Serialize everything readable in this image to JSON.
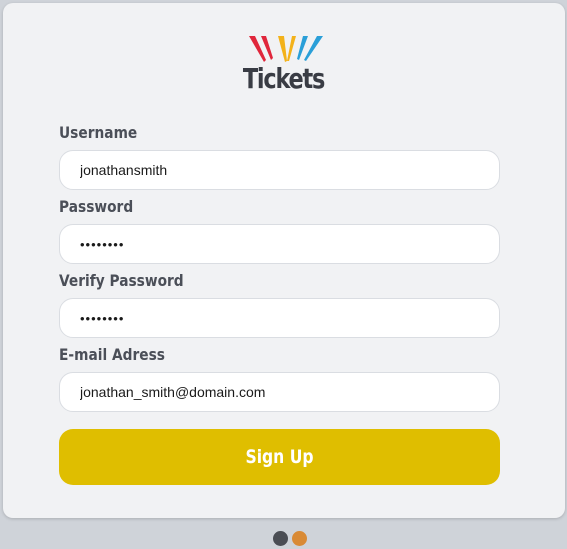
{
  "brand": {
    "name": "Tickets",
    "logo_icon": "ticket-rays-logo",
    "logo_colors": [
      "#e0263b",
      "#f3b21a",
      "#2a9fd8"
    ]
  },
  "form": {
    "fields": [
      {
        "label": "Username",
        "type": "text",
        "value": "jonathansmith"
      },
      {
        "label": "Password",
        "type": "password",
        "value": "••••••••"
      },
      {
        "label": "Verify Password",
        "type": "password",
        "value": "••••••••"
      },
      {
        "label": "E-mail Adress",
        "type": "email",
        "value": "jonathan_smith@domain.com"
      }
    ],
    "submit_label": "Sign Up"
  },
  "pager": {
    "dots": [
      {
        "state": "active",
        "color": "#4a4d54"
      },
      {
        "state": "inactive",
        "color": "#d98a35"
      }
    ]
  },
  "colors": {
    "accent": "#dfbe00",
    "card_background": "#f1f2f4",
    "page_background": "#cfd3d9"
  }
}
